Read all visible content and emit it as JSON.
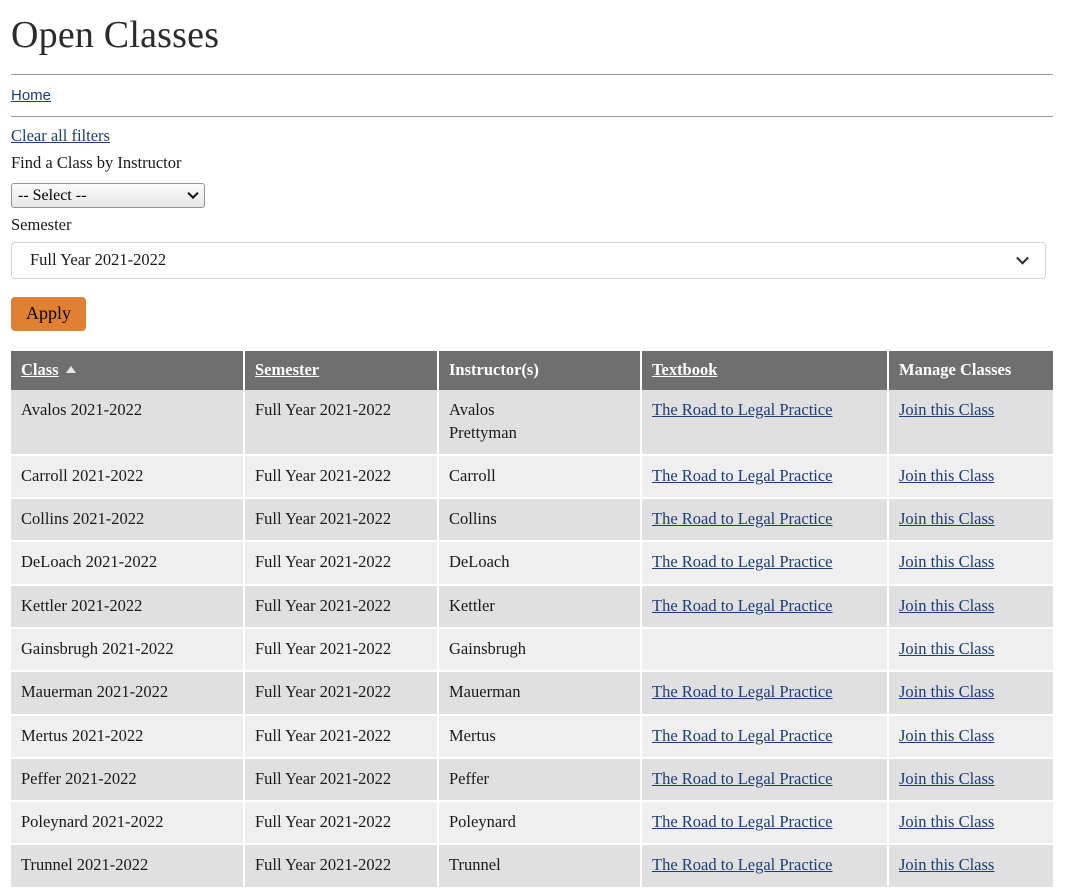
{
  "page_title": "Open Classes",
  "breadcrumb": {
    "home_label": "Home"
  },
  "filters": {
    "clear_label": "Clear all filters",
    "instructor_label": "Find a Class by Instructor",
    "instructor_select_value": "-- Select --",
    "semester_label": "Semester",
    "semester_select_value": "Full Year 2021-2022",
    "apply_label": "Apply"
  },
  "table": {
    "columns": [
      {
        "label": "Class",
        "sortable": true,
        "sorted": "asc"
      },
      {
        "label": "Semester",
        "sortable": true,
        "sorted": "none"
      },
      {
        "label": "Instructor(s)",
        "sortable": false,
        "sorted": "none"
      },
      {
        "label": "Textbook",
        "sortable": true,
        "sorted": "none"
      },
      {
        "label": "Manage Classes",
        "sortable": false,
        "sorted": "none"
      }
    ],
    "rows": [
      {
        "class": "Avalos 2021-2022",
        "semester": "Full Year 2021-2022",
        "instructors": [
          "Avalos",
          "Prettyman"
        ],
        "textbook": "The Road to Legal Practice",
        "manage": "Join this Class"
      },
      {
        "class": "Carroll 2021-2022",
        "semester": "Full Year 2021-2022",
        "instructors": [
          "Carroll"
        ],
        "textbook": "The Road to Legal Practice",
        "manage": "Join this Class"
      },
      {
        "class": "Collins 2021-2022",
        "semester": "Full Year 2021-2022",
        "instructors": [
          "Collins"
        ],
        "textbook": "The Road to Legal Practice",
        "manage": "Join this Class"
      },
      {
        "class": "DeLoach 2021-2022",
        "semester": "Full Year 2021-2022",
        "instructors": [
          "DeLoach"
        ],
        "textbook": "The Road to Legal Practice",
        "manage": "Join this Class"
      },
      {
        "class": "Kettler 2021-2022",
        "semester": "Full Year 2021-2022",
        "instructors": [
          "Kettler"
        ],
        "textbook": "The Road to Legal Practice",
        "manage": "Join this Class"
      },
      {
        "class": "Gainsbrugh 2021-2022",
        "semester": "Full Year 2021-2022",
        "instructors": [
          "Gainsbrugh"
        ],
        "textbook": "",
        "manage": "Join this Class"
      },
      {
        "class": "Mauerman 2021-2022",
        "semester": "Full Year 2021-2022",
        "instructors": [
          "Mauerman"
        ],
        "textbook": "The Road to Legal Practice",
        "manage": "Join this Class"
      },
      {
        "class": "Mertus 2021-2022",
        "semester": "Full Year 2021-2022",
        "instructors": [
          "Mertus"
        ],
        "textbook": "The Road to Legal Practice",
        "manage": "Join this Class"
      },
      {
        "class": "Peffer 2021-2022",
        "semester": "Full Year 2021-2022",
        "instructors": [
          "Peffer"
        ],
        "textbook": "The Road to Legal Practice",
        "manage": "Join this Class"
      },
      {
        "class": "Poleynard 2021-2022",
        "semester": "Full Year 2021-2022",
        "instructors": [
          "Poleynard"
        ],
        "textbook": "The Road to Legal Practice",
        "manage": "Join this Class"
      },
      {
        "class": "Trunnel 2021-2022",
        "semester": "Full Year 2021-2022",
        "instructors": [
          "Trunnel"
        ],
        "textbook": "The Road to Legal Practice",
        "manage": "Join this Class"
      }
    ]
  },
  "colors": {
    "accent_button": "#e08030",
    "table_header_bg": "#6f6f6f",
    "link": "#1c3d78",
    "row_odd": "#e0e0e0",
    "row_even": "#efefef"
  }
}
